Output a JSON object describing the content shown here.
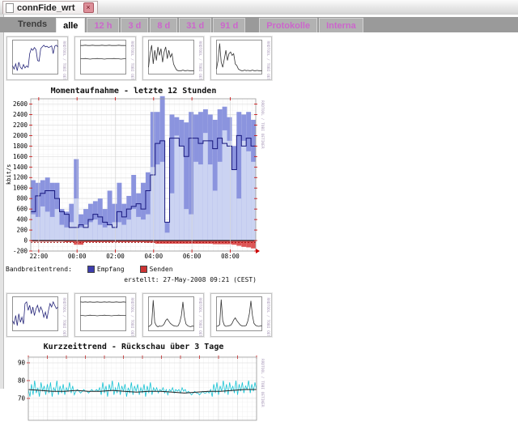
{
  "window": {
    "title": "connFide_wrt"
  },
  "icons": {
    "close": "×",
    "document": "doc"
  },
  "tabs": {
    "section_label": "Trends",
    "items": [
      "alle",
      "12 h",
      "3 d",
      "8 d",
      "31 d",
      "91 d"
    ],
    "links": [
      "Protokolle",
      "Interna"
    ]
  },
  "colors": {
    "link_pink": "#cc66cc",
    "strip_bg": "#9a9a9a",
    "area_max": "#8b94de",
    "area_avg": "#cbd3f2",
    "trend_line": "#17177e",
    "senden_fill": "#dd5555",
    "senden_line": "#990000",
    "legend_empfang": "#3d3dae",
    "legend_senden": "#cc3333",
    "cyan": "#17c3d4",
    "bottom_trend": "#222222",
    "watermark": "#a898b8",
    "grid": "#e7e7e7",
    "axis_red": "#cc0000"
  },
  "watermark_text": "RRDTOOL / TOBI OETIKER",
  "chart_data": [
    {
      "id": "main",
      "type": "area",
      "title": "Momentaufnahme - letzte 12 Stunden",
      "ylabel": "kbit/s",
      "ylim": [
        -200,
        2700
      ],
      "ytick_step": 200,
      "yticks": [
        -200,
        0,
        200,
        400,
        600,
        800,
        1000,
        1200,
        1400,
        1600,
        1800,
        2000,
        2200,
        2400,
        2600
      ],
      "xticks": [
        "22:00",
        "00:00",
        "02:00",
        "04:00",
        "06:00",
        "08:00"
      ],
      "xtick_frac": [
        0.0355,
        0.2057,
        0.3759,
        0.5461,
        0.7163,
        0.8865
      ],
      "legend_label": "Bandbreitentrend:",
      "legend": [
        {
          "name": "Empfang"
        },
        {
          "name": "Senden"
        }
      ],
      "footer": "erstellt: 27-May-2008 09:21 (CEST)",
      "senden_trend": -35,
      "series": {
        "max": [
          1150,
          1100,
          1150,
          1200,
          1100,
          1100,
          600,
          550,
          700,
          1550,
          500,
          600,
          700,
          750,
          800,
          600,
          950,
          700,
          1100,
          700,
          850,
          1250,
          900,
          1100,
          1300,
          2450,
          2450,
          2750,
          350,
          2400,
          2350,
          2300,
          2250,
          2450,
          2400,
          2450,
          2500,
          2400,
          2300,
          2500,
          2550,
          2350,
          1800,
          2450,
          2400,
          2450,
          2300
        ],
        "avg": [
          500,
          450,
          650,
          550,
          450,
          600,
          300,
          250,
          350,
          800,
          250,
          300,
          350,
          400,
          300,
          250,
          300,
          350,
          350,
          300,
          400,
          600,
          450,
          400,
          500,
          1400,
          1450,
          1500,
          150,
          900,
          2000,
          1800,
          600,
          500,
          1500,
          1450,
          2050,
          1450,
          950,
          1500,
          2100,
          1900,
          1350,
          800,
          1900,
          1700,
          1500
        ],
        "trend": [
          550,
          850,
          900,
          950,
          950,
          800,
          550,
          500,
          250,
          250,
          300,
          250,
          400,
          500,
          450,
          350,
          300,
          250,
          550,
          450,
          600,
          650,
          700,
          600,
          950,
          1250,
          1850,
          1900,
          350,
          1950,
          1950,
          1800,
          1600,
          1950,
          1950,
          1850,
          1900,
          1900,
          1750,
          1950,
          1850,
          1800,
          1350,
          2000,
          1800,
          1950,
          1800
        ],
        "senden": [
          -20,
          -20,
          -20,
          -20,
          -20,
          -20,
          -20,
          -30,
          -30,
          -80,
          -80,
          -30,
          -30,
          -30,
          -30,
          -30,
          -30,
          -30,
          -30,
          -30,
          -30,
          -30,
          -30,
          -30,
          -40,
          -40,
          -60,
          -60,
          -60,
          -60,
          -60,
          -60,
          -60,
          -60,
          -60,
          -60,
          -60,
          -60,
          -70,
          -70,
          -70,
          -70,
          -80,
          -100,
          -120,
          -130,
          -150
        ]
      }
    },
    {
      "id": "bottom",
      "type": "line",
      "title": "Kurzzeittrend - Rückschau über 3 Tage",
      "ylim": [
        66,
        92
      ],
      "yticks": [
        70,
        80,
        90
      ],
      "series": {
        "noisy": [
          75,
          71,
          78,
          72,
          80,
          73,
          76,
          71,
          79,
          74,
          77,
          72,
          78,
          73,
          79,
          71,
          76,
          74,
          80,
          72,
          77,
          73,
          78,
          72,
          76,
          74,
          79,
          73,
          77,
          72,
          74,
          75,
          74,
          73,
          74,
          75,
          74,
          74,
          73,
          74,
          75,
          74,
          74,
          75,
          74,
          76,
          72,
          79,
          73,
          77,
          71,
          78,
          74,
          80,
          72,
          76,
          73,
          79,
          72,
          77,
          74,
          78,
          71,
          76,
          73,
          79,
          72,
          77,
          74,
          78,
          72,
          76,
          73,
          78,
          71,
          77,
          73,
          79,
          72,
          76,
          74,
          76,
          73,
          75,
          74,
          76,
          73,
          75,
          72,
          75,
          74,
          76,
          73,
          75,
          74,
          75,
          73,
          76,
          74,
          75,
          73,
          74,
          73,
          72,
          73,
          74,
          73,
          73,
          72,
          73,
          74,
          73,
          73,
          74,
          73,
          75,
          71,
          78,
          73,
          79,
          72,
          77,
          74,
          80,
          73,
          78,
          72,
          79,
          74,
          77,
          73,
          80,
          72,
          78,
          74,
          79,
          73,
          77,
          75,
          80,
          73,
          78,
          74,
          79,
          75
        ],
        "trend": [
          75,
          74.5,
          74,
          74,
          74.5,
          74,
          74,
          74.5,
          74,
          73.5,
          74,
          74,
          73.5,
          73,
          73.5,
          74,
          74,
          74.5,
          75,
          75
        ]
      }
    },
    {
      "id": "t1",
      "type": "sparkline",
      "lines": [
        {
          "color": "#26267a",
          "v": [
            25,
            15,
            30,
            10,
            35,
            20,
            15,
            28,
            18,
            24,
            20,
            60,
            75,
            70,
            78,
            72,
            40,
            38,
            75,
            80,
            85,
            80,
            82,
            78,
            80,
            83,
            60,
            82,
            85,
            80
          ]
        }
      ]
    },
    {
      "id": "t2",
      "type": "sparkline",
      "lines": [
        {
          "color": "#333333",
          "v": [
            84,
            84,
            85,
            84,
            84,
            85,
            84,
            84,
            84,
            85,
            84,
            84,
            85,
            84,
            84,
            84,
            85,
            84,
            84,
            84
          ]
        },
        {
          "color": "#333333",
          "v": [
            45,
            45,
            46,
            45,
            44,
            45,
            45,
            46,
            45,
            45,
            44,
            45,
            45,
            45,
            46,
            45,
            45,
            44,
            45,
            45
          ]
        }
      ]
    },
    {
      "id": "t3",
      "type": "sparkline",
      "lines": [
        {
          "color": "#333333",
          "v": [
            20,
            60,
            85,
            30,
            70,
            40,
            80,
            55,
            75,
            35,
            65,
            80,
            45,
            70,
            50,
            60,
            30,
            20,
            12,
            10,
            10,
            10,
            12,
            10,
            10,
            11,
            10,
            10,
            10,
            10
          ]
        }
      ]
    },
    {
      "id": "t4",
      "type": "sparkline",
      "lines": [
        {
          "color": "#333333",
          "v": [
            15,
            40,
            90,
            35,
            20,
            45,
            70,
            40,
            60,
            65,
            55,
            60,
            30,
            25,
            15,
            12,
            10,
            10,
            12,
            10,
            11,
            10,
            10,
            12,
            10,
            10,
            11,
            10,
            10,
            10
          ]
        }
      ]
    },
    {
      "id": "t5",
      "type": "sparkline",
      "lines": [
        {
          "color": "#26267a",
          "v": [
            30,
            20,
            45,
            15,
            50,
            25,
            40,
            20,
            80,
            85,
            60,
            75,
            50,
            70,
            45,
            65,
            75,
            55,
            70,
            60,
            40,
            55,
            35,
            60,
            80,
            70,
            85,
            75,
            65,
            70
          ]
        }
      ]
    },
    {
      "id": "t6",
      "type": "sparkline",
      "lines": [
        {
          "color": "#333333",
          "v": [
            85,
            84,
            85,
            84,
            85,
            84,
            84,
            85,
            84,
            84,
            85,
            84,
            85,
            84,
            84,
            85,
            84,
            84,
            85,
            84
          ]
        },
        {
          "color": "#333333",
          "v": [
            45,
            45,
            44,
            45,
            46,
            45,
            45,
            44,
            45,
            45,
            46,
            45,
            45,
            44,
            45,
            45,
            46,
            45,
            45,
            45
          ]
        }
      ]
    },
    {
      "id": "t7",
      "type": "sparkline",
      "lines": [
        {
          "color": "#333333",
          "v": [
            12,
            15,
            20,
            90,
            25,
            15,
            12,
            14,
            13,
            15,
            20,
            30,
            35,
            28,
            22,
            18,
            15,
            14,
            13,
            15,
            25,
            45,
            85,
            40,
            20,
            15,
            13,
            12,
            14,
            13
          ]
        }
      ]
    },
    {
      "id": "t8",
      "type": "sparkline",
      "lines": [
        {
          "color": "#333333",
          "v": [
            13,
            14,
            18,
            92,
            30,
            16,
            13,
            14,
            15,
            16,
            22,
            32,
            38,
            30,
            24,
            18,
            15,
            14,
            14,
            16,
            28,
            50,
            88,
            45,
            22,
            16,
            14,
            13,
            14,
            15
          ]
        }
      ]
    }
  ]
}
